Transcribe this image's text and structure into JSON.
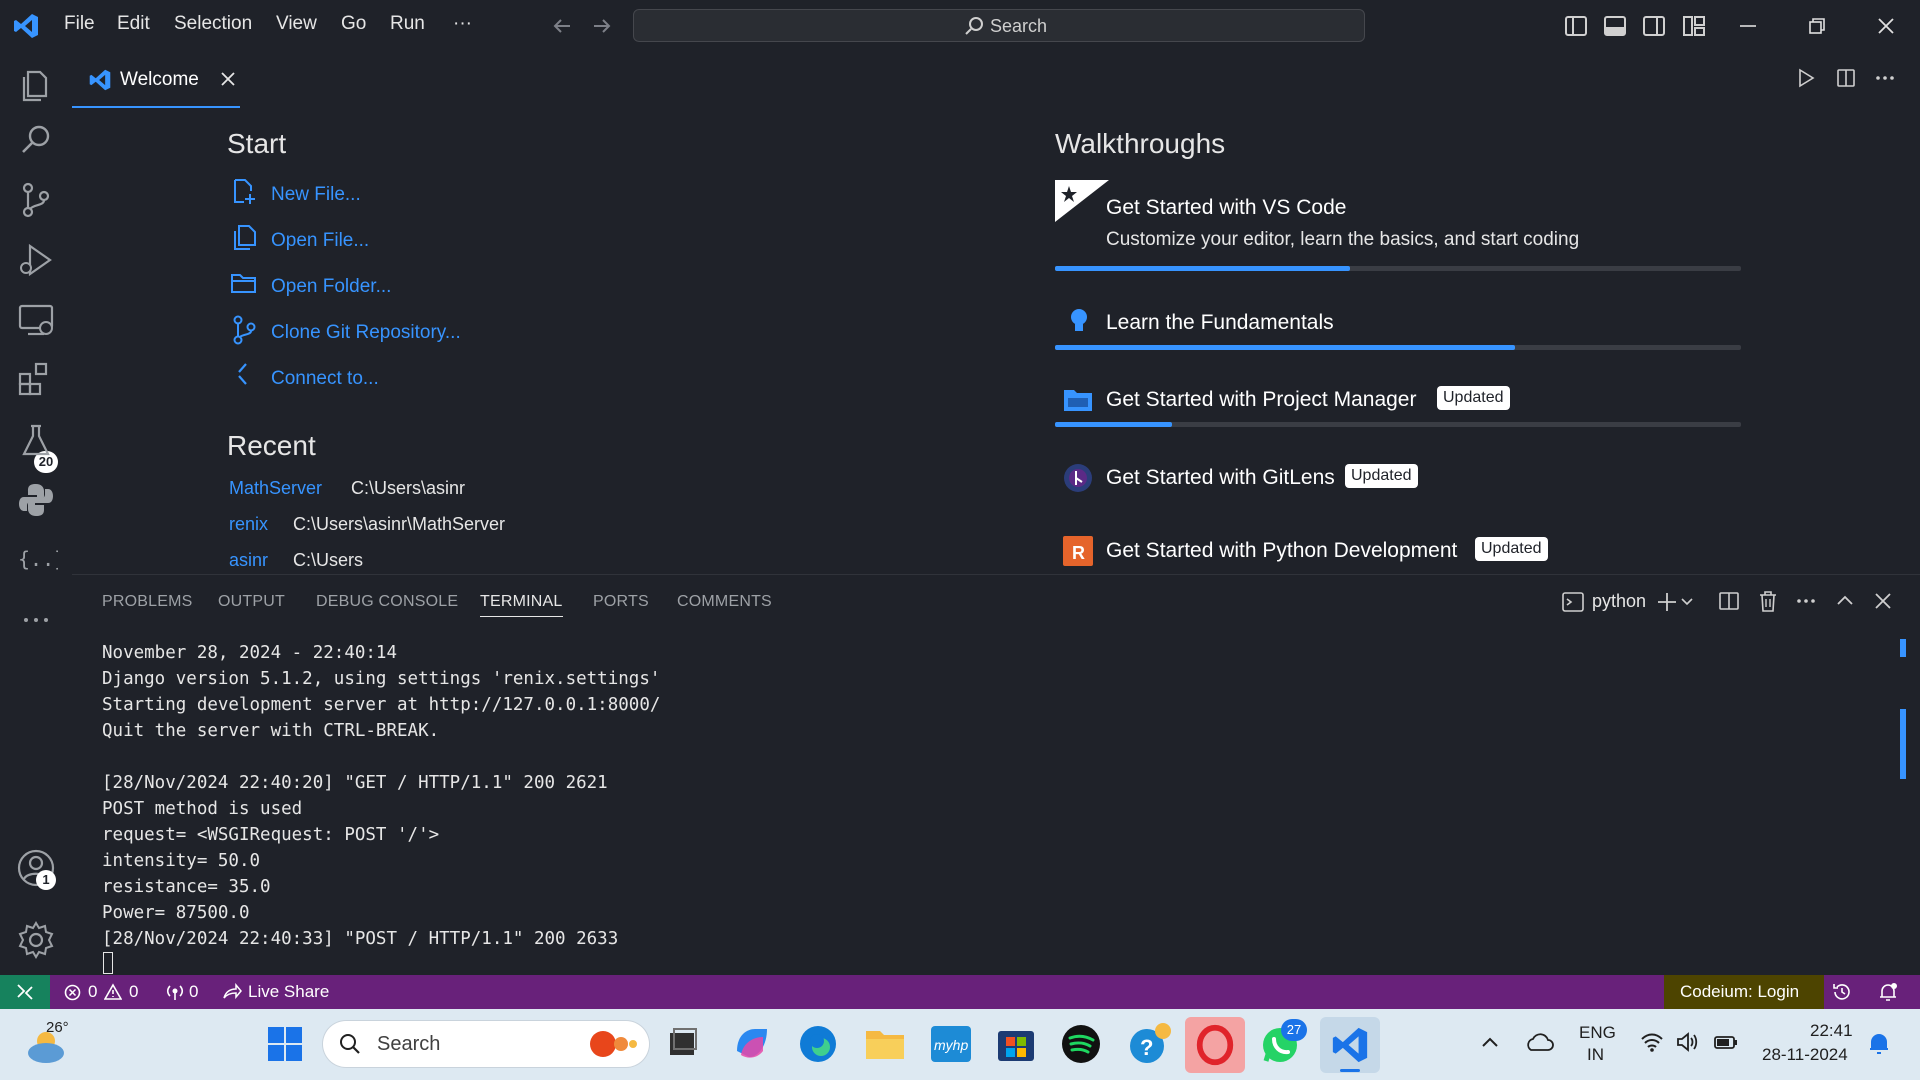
{
  "menu": [
    "File",
    "Edit",
    "Selection",
    "View",
    "Go",
    "Run",
    "···"
  ],
  "search": {
    "label": "Search"
  },
  "activity": {
    "extensions_badge": "20",
    "accounts_badge": "1"
  },
  "tab": {
    "label": "Welcome"
  },
  "start": {
    "heading": "Start",
    "links": [
      "New File...",
      "Open File...",
      "Open Folder...",
      "Clone Git Repository...",
      "Connect to..."
    ]
  },
  "recent": {
    "heading": "Recent",
    "items": [
      {
        "name": "MathServer",
        "path": "C:\\Users\\asinr"
      },
      {
        "name": "renix",
        "path": "C:\\Users\\asinr\\MathServer"
      },
      {
        "name": "asinr",
        "path": "C:\\Users"
      }
    ]
  },
  "walkthroughs": {
    "heading": "Walkthroughs",
    "items": [
      {
        "title": "Get Started with VS Code",
        "desc": "Customize your editor, learn the basics, and start coding",
        "progress": 0.43,
        "badge": ""
      },
      {
        "title": "Learn the Fundamentals",
        "desc": "",
        "progress": 0.67,
        "badge": ""
      },
      {
        "title": "Get Started with Project Manager",
        "desc": "",
        "progress": 0.17,
        "badge": "Updated"
      },
      {
        "title": "Get Started with GitLens",
        "desc": "",
        "progress": null,
        "badge": "Updated"
      },
      {
        "title": "Get Started with Python Development",
        "desc": "",
        "progress": null,
        "badge": "Updated"
      }
    ]
  },
  "panel": {
    "tabs": [
      "PROBLEMS",
      "OUTPUT",
      "DEBUG CONSOLE",
      "TERMINAL",
      "PORTS",
      "COMMENTS"
    ],
    "active_tab": "TERMINAL",
    "terminal_name": "python",
    "terminal_lines": [
      "November 28, 2024 - 22:40:14",
      "Django version 5.1.2, using settings 'renix.settings'",
      "Starting development server at http://127.0.0.1:8000/",
      "Quit the server with CTRL-BREAK.",
      "",
      "[28/Nov/2024 22:40:20] \"GET / HTTP/1.1\" 200 2621",
      "POST method is used",
      "request= <WSGIRequest: POST '/'>",
      "intensity= 50.0",
      "resistance= 35.0",
      "Power= 87500.0",
      "[28/Nov/2024 22:40:33] \"POST / HTTP/1.1\" 200 2633"
    ]
  },
  "status": {
    "errors": "0",
    "warnings": "0",
    "ports": "0",
    "live_share": "Live Share",
    "codeium": "Codeium: Login"
  },
  "taskbar": {
    "weather": "26°",
    "search": "Search",
    "whatsapp_badge": "27",
    "lang1": "ENG",
    "lang2": "IN",
    "time": "22:41",
    "date": "28-11-2024"
  },
  "colors": {
    "accent": "#3794ff",
    "statusbar": "#68217a",
    "background": "#1f2229",
    "codeium_bg": "#4d4400"
  }
}
